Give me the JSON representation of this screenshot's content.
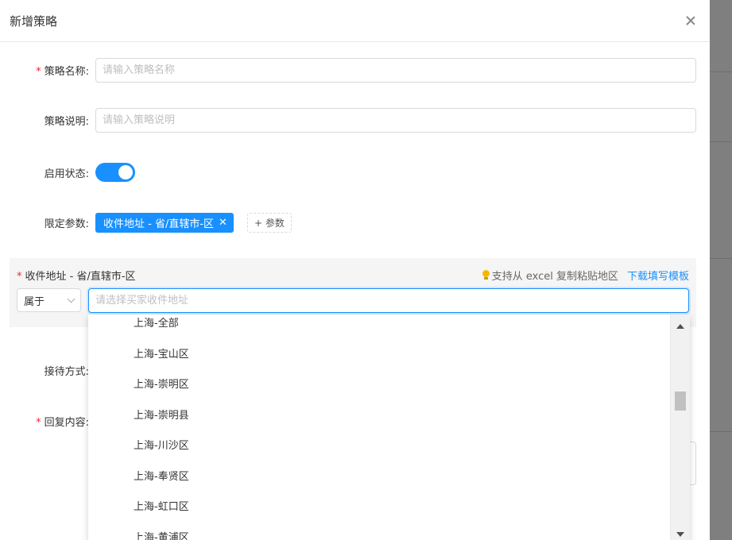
{
  "modal": {
    "title": "新增策略"
  },
  "form": {
    "name": {
      "label": "策略名称:",
      "required_mark": "*",
      "placeholder": "请输入策略名称"
    },
    "description": {
      "label": "策略说明:",
      "placeholder": "请输入策略说明"
    },
    "status": {
      "label": "启用状态:",
      "enabled": true
    },
    "params": {
      "label": "限定参数:",
      "tag": "收件地址 - 省/直辖市-区",
      "tag_close": "✕",
      "add_label": "+ 参数"
    },
    "reception": {
      "label": "接待方式:"
    },
    "reply": {
      "label": "回复内容:",
      "required_mark": "*"
    }
  },
  "condition": {
    "required_mark": "*",
    "label": "收件地址 - 省/直辖市-区",
    "tip": "支持从 excel 复制粘贴地区",
    "link": "下载填写模板",
    "operator": "属于",
    "placeholder": "请选择买家收件地址"
  },
  "dropdown": {
    "items": [
      "上海-全部",
      "上海-宝山区",
      "上海-崇明区",
      "上海-崇明县",
      "上海-川沙区",
      "上海-奉贤区",
      "上海-虹口区",
      "上海-黄浦区"
    ]
  },
  "colors": {
    "primary": "#1890ff",
    "required": "#f5222d"
  }
}
